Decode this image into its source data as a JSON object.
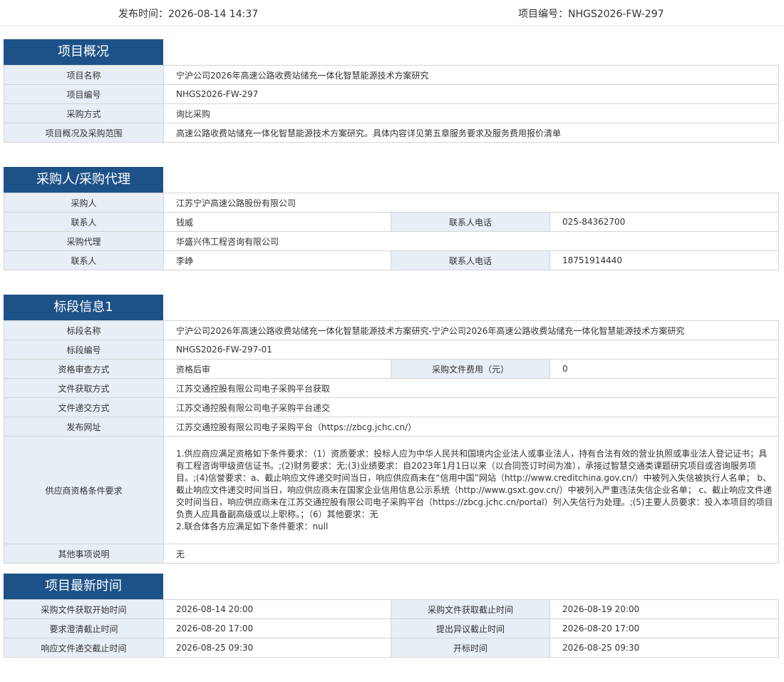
{
  "header": {
    "publish_time": "发布时间：2026-08-14 14:37",
    "project_code": "项目编号：NHGS2026-FW-297"
  },
  "overview": {
    "title": "项目概况",
    "rows": [
      {
        "label": "项目名称",
        "value": "宁沪公司2026年高速公路收费站储充一体化智慧能源技术方案研究"
      },
      {
        "label": "项目编号",
        "value": "NHGS2026-FW-297"
      },
      {
        "label": "采购方式",
        "value": "询比采购"
      },
      {
        "label": "项目概况及采购范围",
        "value": "高速公路收费站储充一体化智慧能源技术方案研究。具体内容详见第五章服务要求及服务费用报价清单"
      }
    ]
  },
  "purchaser": {
    "title": "采购人/采购代理",
    "purchaser_label": "采购人",
    "purchaser_value": "江苏宁沪高速公路股份有限公司",
    "contact1_label": "联系人",
    "contact1_value": "钱威",
    "phone1_label": "联系人电话",
    "phone1_value": "025-84362700",
    "agent_label": "采购代理",
    "agent_value": "华盛兴伟工程咨询有限公司",
    "contact2_label": "联系人",
    "contact2_value": "李峥",
    "phone2_label": "联系人电话",
    "phone2_value": "18751914440"
  },
  "lot": {
    "title": "标段信息1",
    "name_label": "标段名称",
    "name_value": "宁沪公司2026年高速公路收费站储充一体化智慧能源技术方案研究-宁沪公司2026年高速公路收费站储充一体化智慧能源技术方案研究",
    "code_label": "标段编号",
    "code_value": "NHGS2026-FW-297-01",
    "review_label": "资格审查方式",
    "review_value": "资格后审",
    "fee_label": "采购文件费用（元）",
    "fee_value": "0",
    "get_label": "文件获取方式",
    "get_value": "江苏交通控股有限公司电子采购平台获取",
    "submit_label": "文件递交方式",
    "submit_value": "江苏交通控股有限公司电子采购平台递交",
    "site_label": "发布网址",
    "site_value": "江苏交通控股有限公司电子采购平台（https://zbcg.jchc.cn/）",
    "qual_label": "供应商资格条件要求",
    "qual_line1": "1.供应商应满足资格如下条件要求：（1）资质要求：投标人应为中华人民共和国境内企业法人或事业法人，持有合法有效的营业执照或事业法人登记证书；具有工程咨询甲级资信证书。;(2)财务要求：无;(3)业绩要求：自2023年1月1日以来（以合同签订时间为准），承接过智慧交通类课题研究项目或咨询服务项目。;(4)信誉要求：a、截止响应文件递交时间当日，响应供应商未在“信用中国”网站（http://www.creditchina.gov.cn/）中被列入失信被执行人名单； b、截止响应文件递交时间当日，响应供应商未在国家企业信用信息公示系统（http://www.gsxt.gov.cn/）中被列入严重违法失信企业名单； c、截止响应文件递交时间当日，响应供应商未在江苏交通控股有限公司电子采购平台（https://zbcg.jchc.cn/portal）列入失信行为处理。;(5)主要人员要求：投入本项目的项目负责人应具备副高级或以上职称。；（6）其他要求：无",
    "qual_line2": "2.联合体各方应满足如下条件要求：null",
    "other_label": "其他事项说明",
    "other_value": "无"
  },
  "timeline": {
    "title": "项目最新时间",
    "rows": [
      {
        "l1": "采购文件获取开始时间",
        "v1": "2026-08-14 20:00",
        "l2": "采购文件获取截止时间",
        "v2": "2026-08-19 20:00"
      },
      {
        "l1": "要求澄清截止时间",
        "v1": "2026-08-20 17:00",
        "l2": "提出异议截止时间",
        "v2": "2026-08-20 17:00"
      },
      {
        "l1": "响应文件递交截止时间",
        "v1": "2026-08-25 09:30",
        "l2": "开标时间",
        "v2": "2026-08-25 09:30"
      }
    ]
  }
}
